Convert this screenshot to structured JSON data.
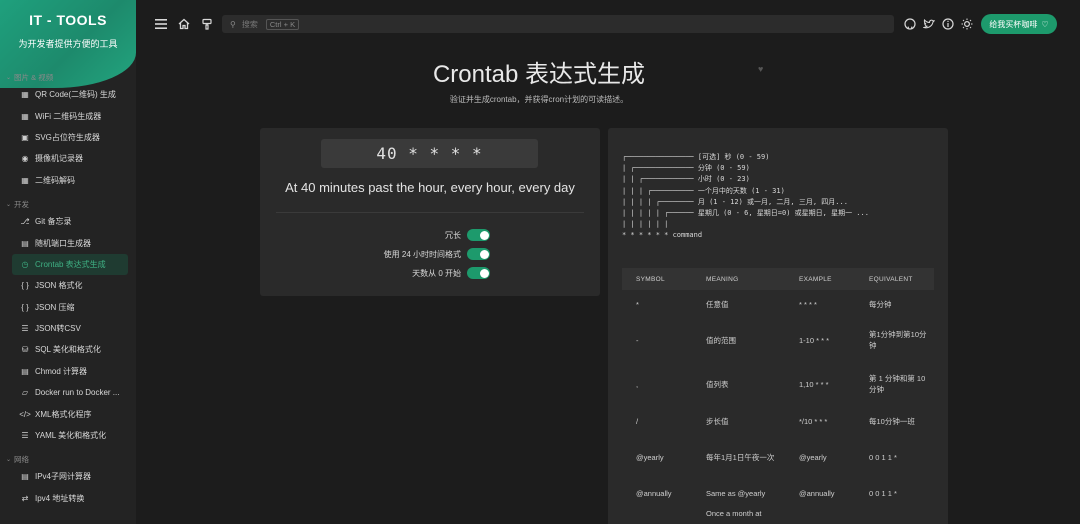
{
  "sidebar": {
    "app_title": "IT - TOOLS",
    "app_subtitle": "为开发者提供方便的工具",
    "groups": [
      {
        "label": "图片 & 视频",
        "items": [
          {
            "label": "QR Code(二维码) 生成",
            "icon": "qr-icon"
          },
          {
            "label": "WiFi 二维码生成器",
            "icon": "qr-icon"
          },
          {
            "label": "SVG占位符生成器",
            "icon": "image-icon"
          },
          {
            "label": "摄像机记录器",
            "icon": "camera-icon"
          },
          {
            "label": "二维码解码",
            "icon": "qr-icon"
          }
        ]
      },
      {
        "label": "开发",
        "items": [
          {
            "label": "Git 备忘录",
            "icon": "git-icon"
          },
          {
            "label": "随机端口生成器",
            "icon": "server-icon"
          },
          {
            "label": "Crontab 表达式生成",
            "icon": "alarm-icon",
            "active": true
          },
          {
            "label": "JSON 格式化",
            "icon": "braces-icon"
          },
          {
            "label": "JSON 压缩",
            "icon": "braces-icon"
          },
          {
            "label": "JSON转CSV",
            "icon": "list-icon"
          },
          {
            "label": "SQL 美化和格式化",
            "icon": "database-icon"
          },
          {
            "label": "Chmod 计算器",
            "icon": "file-icon"
          },
          {
            "label": "Docker run to Docker ...",
            "icon": "docker-icon"
          },
          {
            "label": "XML格式化程序",
            "icon": "code-icon"
          },
          {
            "label": "YAML 美化和格式化",
            "icon": "align-icon"
          }
        ]
      },
      {
        "label": "网络",
        "items": [
          {
            "label": "IPv4子网计算器",
            "icon": "router-icon"
          },
          {
            "label": "Ipv4 地址转换",
            "icon": "convert-icon"
          }
        ]
      }
    ]
  },
  "header": {
    "search_placeholder": "搜索",
    "search_shortcut": "Ctrl + K",
    "buy_label": "给我买杯咖啡"
  },
  "page": {
    "title": "Crontab 表达式生成",
    "subtitle": "验证并生成crontab，并获得cron计划的可读描述。"
  },
  "generator": {
    "expression": "40 * * * *",
    "description": "At 40 minutes past the hour, every hour, every day",
    "options": [
      {
        "label": "冗长",
        "on": true
      },
      {
        "label": "使用 24 小时时间格式",
        "on": true
      },
      {
        "label": "天数从 0 开始",
        "on": true
      }
    ]
  },
  "help": {
    "diagram": [
      "┌──────────────── [可选] 秒 (0 - 59)",
      "| ┌────────────── 分钟 (0 - 59)",
      "| | ┌──────────── 小时 (0 - 23)",
      "| | | ┌────────── 一个月中的天数 (1 - 31)",
      "| | | | ┌──────── 月 (1 - 12) 或一月, 二月, 三月, 四月...",
      "| | | | | ┌────── 星期几 (0 - 6, 星期日=0) 或星期日, 星期一 ...",
      "| | | | | |",
      "* * * * * * command"
    ],
    "table": {
      "headers": [
        "SYMBOL",
        "MEANING",
        "EXAMPLE",
        "EQUIVALENT"
      ],
      "rows": [
        [
          "*",
          "任意值",
          "* * * *",
          "每分钟"
        ],
        [
          "-",
          "值的范围",
          "1-10 * * *",
          "第1分钟到第10分钟"
        ],
        [
          ",",
          "值列表",
          "1,10 * * *",
          "第 1 分钟和第 10 分钟"
        ],
        [
          "/",
          "步长值",
          "*/10 * * *",
          "每10分钟一班"
        ],
        [
          "@yearly",
          "每年1月1日午夜一次",
          "@yearly",
          "0 0 1 1 *"
        ],
        [
          "@annually",
          "Same as @yearly",
          "@annually",
          "0 0 1 1 *"
        ],
        [
          "",
          "Once a month at",
          "",
          ""
        ]
      ]
    }
  },
  "colors": {
    "accent": "#1d9a6c",
    "active_bg": "#1f3b31",
    "card": "#2a2a2a",
    "bg": "#1c1c1c"
  }
}
